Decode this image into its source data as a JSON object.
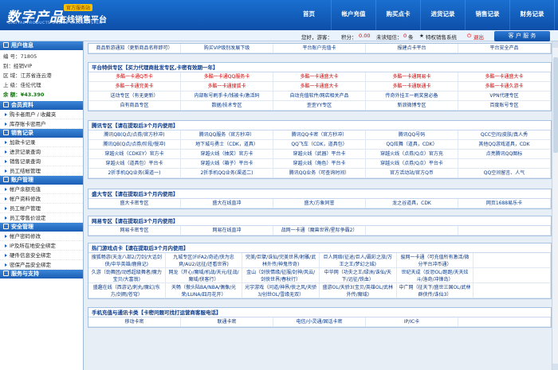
{
  "header": {
    "logo_main": "数字产品",
    "logo_badge": "官方服务站",
    "logo_sub": "在线销售平台",
    "logo_en": "DIGITAL PRODUCTS ONLINE SALES SYSTEM",
    "nav": [
      "首页",
      "帐户充值",
      "购买点卡",
      "进货记录",
      "销售记录",
      "财务记录"
    ]
  },
  "infobar": {
    "greeting": "您好，游客：",
    "points_label": "积分：",
    "points_value": "0.00",
    "unread_label": "未读短信：",
    "unread_value": "0",
    "unread_unit": "条",
    "special_label": "特权销售系统",
    "logout_label": "退出",
    "service_button": "客 户 服 务"
  },
  "sidebar": {
    "user_header": "用户信息",
    "user_rows": [
      "编 号：71805",
      "别：经销VIP",
      "区 域：江苏省连云港",
      "上 级：佳伦代理",
      "余 额：¥43.390"
    ],
    "groups": [
      {
        "title": "会员资料",
        "items": [
          "购卡者用户 / 收藏夹",
          "库存账卡密用户"
        ]
      },
      {
        "title": "销售记录",
        "items": [
          "加款卡记录",
          "进货记录查询",
          "销售记录查询",
          "员工结帐管理"
        ]
      },
      {
        "title": "账户管理",
        "items": [
          "帐户余额充值",
          "帐户资料修改",
          "员工帐户管理",
          "员工零售价设定"
        ]
      },
      {
        "title": "安全管理",
        "items": [
          "帐户密码修改",
          "IP及所在地安全绑定",
          "硬件信息安全绑定",
          "密保产品安全绑定"
        ]
      },
      {
        "title": "服务与支持",
        "items": []
      }
    ]
  },
  "top_links": [
    "商品新游通知（更新商品名称即可）",
    "购买VIP级别发展下级",
    "平台账户充值卡",
    "报建点卡平台",
    "平台安全产品"
  ],
  "sections": [
    {
      "title": "平台特供专区【买力代理商批发专区,卡密有效期一年】",
      "cols": 5,
      "cells": [
        {
          "t": "多酷一卡通Q币卡",
          "r": true
        },
        {
          "t": "多酷一卡通QQ服务卡",
          "r": true
        },
        {
          "t": "多酷一卡通盛大卡",
          "r": true
        },
        {
          "t": "多酷一卡通网易卡",
          "r": true
        },
        {
          "t": "多酷一卡通盛大卡",
          "r": true
        },
        {
          "t": "多酷一卡通完美卡",
          "r": true
        },
        {
          "t": "多酷一卡通搜狐卡",
          "r": true
        },
        {
          "t": "多酷一卡通盛大卡",
          "r": true
        },
        {
          "t": "多酷一卡通联通卡",
          "r": true
        },
        {
          "t": "多酷一卡通久游卡",
          "r": true
        },
        {
          "t": "送动专区（有无更新）"
        },
        {
          "t": "内部账号刷手卡/钱被卡/激活码"
        },
        {
          "t": "自动充值软件/网店相关产品"
        },
        {
          "t": "传奇外挂王一刷奖营必备"
        },
        {
          "t": "VPN代理专区"
        },
        {
          "t": "自有商品专区"
        },
        {
          "t": "数据/技术专区"
        },
        {
          "t": "歪歪YY专区"
        },
        {
          "t": "新浪微博专区"
        },
        {
          "t": "百度账号专区"
        }
      ]
    },
    {
      "title": "腾讯专区【请在提取后3个月内使用】",
      "cols": 5,
      "cells": [
        {
          "t": "腾讯QB(Q点/点券/官方秒冲)"
        },
        {
          "t": "腾讯QQ服务（官方秒冲）"
        },
        {
          "t": "腾讯QQ卡密（官方秒冲）"
        },
        {
          "t": "腾讯QQ号码"
        },
        {
          "t": "QCC空间/皮肤/真人秀"
        },
        {
          "t": "腾讯QB(Q点/点券/阶段/慢冲)"
        },
        {
          "t": "地下城与勇士（CDK，道具）"
        },
        {
          "t": "QQ飞车（CDK，道具包）"
        },
        {
          "t": "QQ炫舞（道具，CDK）"
        },
        {
          "t": "其他QQ游戏道具，CDK"
        },
        {
          "t": "穿越火线（CDKEY）官方卡"
        },
        {
          "t": "穿越火线（抽奖）官方卡"
        },
        {
          "t": "穿越火线（武器）平台卡"
        },
        {
          "t": "穿越火线（点券/Q点）官方充"
        },
        {
          "t": "点亮腾讯QQ图标"
        },
        {
          "t": "穿越火线（道具包）平台卡"
        },
        {
          "t": "穿越火线（箱子）平台卡"
        },
        {
          "t": "穿越火线（角色）平台卡"
        },
        {
          "t": "穿越火线（点券/Q点）平台卡"
        },
        {
          "t": ""
        },
        {
          "t": "2折手机QQ业务(渠道一)"
        },
        {
          "t": "2折手机QQ业务(渠道二)"
        },
        {
          "t": "腾讯QQ业务（可查询时间）"
        },
        {
          "t": "官方活动站/官方Q币"
        },
        {
          "t": "QQ空间留言、人气"
        }
      ]
    },
    {
      "title": "盛大专区【请在提取后3个月内使用】",
      "cols": 5,
      "cells": [
        {
          "t": "盛大卡密专区"
        },
        {
          "t": "盛大在线直冲"
        },
        {
          "t": "盛大/方象同誉"
        },
        {
          "t": "龙之谷道具，CDK"
        },
        {
          "t": "网页1688易乐卡"
        }
      ]
    },
    {
      "title": "网易专区【请在提取后3个月内使用】",
      "cols": 5,
      "cells": [
        {
          "t": "网易卡密专区"
        },
        {
          "t": "网易在线直冲"
        },
        {
          "t": "战网一卡通（魔兽世界/星际争霸2）"
        },
        {
          "t": ""
        },
        {
          "t": ""
        }
      ]
    },
    {
      "title": "热门游戏点卡【请在提取后3个月内使用】",
      "cols": 6,
      "cells": [
        {
          "t": "搜狐畅游(天龙八部2/刀剑/大话剑侠/中华英雄/鹿鼎记)"
        },
        {
          "t": "九城专区(FIFA2/奇迹/侠为忠爽/AU2/远征/还看世界)"
        },
        {
          "t": "完美/巨擘/诛仙/完美世界/射雕/武林外传/神鬼传奇)"
        },
        {
          "t": "巨人网络(征途/巨人/霸彩之旅/万王之王/梦幻之城)"
        },
        {
          "t": "骏网一卡通（可充值所有激活/微分平台冲币通）"
        },
        {
          "t": ""
        },
        {
          "t": "久游（劲舞团/动感超级舞者/魔力宝贝/大富翁)"
        },
        {
          "t": "网龙（开心/魔域/机战/天元/征战/魔域/侠客行）"
        },
        {
          "t": "金山（剑侠情缘/征服/封神/风云/剑侠世界/春秋行）"
        },
        {
          "t": "中华网（功夫之王/绿洲/诛仙/天下/远征/铁血）"
        },
        {
          "t": "世纪天成（反恐OL/跑跑/天天炫斗/洛奇/冲锋岛）"
        },
        {
          "t": ""
        },
        {
          "t": "盛趣在线（西游记/刺丸/魔幻/东方/剑雨/苍穹）"
        },
        {
          "t": "天畅（傲头陆BA/NBA/偶像/光荣/LUNA/四月花开）"
        },
        {
          "t": "光宇游戏（问道/神界/侠之风/天骄3/创世OL/雪缘无双）"
        },
        {
          "t": "盛游OL/天骄3(宝贝/英雄OL/武林外传/魔域)"
        },
        {
          "t": "中广网（征天下/盛世三国OL/武林群侠传/诛仙3）"
        },
        {
          "t": ""
        }
      ]
    },
    {
      "title": "手机充值与通讯卡类【卡密问题可找打运营商客服电话】",
      "cols": 5,
      "cells": [
        {
          "t": "移动卡密"
        },
        {
          "t": "联通卡密"
        },
        {
          "t": "电信/小灵通/固话卡密"
        },
        {
          "t": "IP/IC卡"
        },
        {
          "t": ""
        }
      ]
    }
  ]
}
